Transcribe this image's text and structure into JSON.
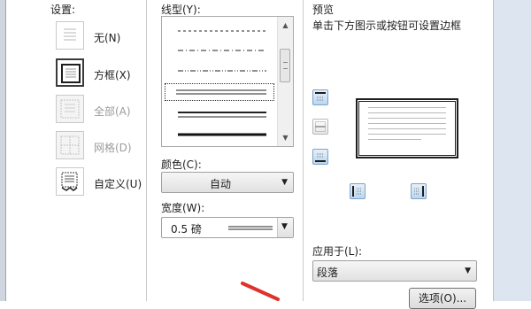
{
  "setting": {
    "title": "设置:",
    "options": [
      {
        "label": "无(N)",
        "icon": "border-none-icon",
        "enabled": true,
        "selected": false
      },
      {
        "label": "方框(X)",
        "icon": "border-box-icon",
        "enabled": true,
        "selected": true
      },
      {
        "label": "全部(A)",
        "icon": "border-all-icon",
        "enabled": false,
        "selected": false
      },
      {
        "label": "网格(D)",
        "icon": "border-grid-icon",
        "enabled": false,
        "selected": false
      },
      {
        "label": "自定义(U)",
        "icon": "border-custom-icon",
        "enabled": true,
        "selected": false
      }
    ]
  },
  "style": {
    "title": "线型(Y):",
    "lines": [
      "dashed",
      "dash-dot",
      "dash-dot-dot",
      "double",
      "thick-thin",
      "thick"
    ],
    "selected_index": 3,
    "color_label": "颜色(C):",
    "color_value": "自动",
    "width_label": "宽度(W):",
    "width_value": "0.5 磅"
  },
  "preview": {
    "title": "预览",
    "hint": "单击下方图示或按钮可设置边框",
    "apply_label": "应用于(L):",
    "apply_value": "段落",
    "options_button": "选项(O)..."
  },
  "colors": {
    "accent": "#e0312b",
    "selection_blue": "#7fa3c8"
  }
}
